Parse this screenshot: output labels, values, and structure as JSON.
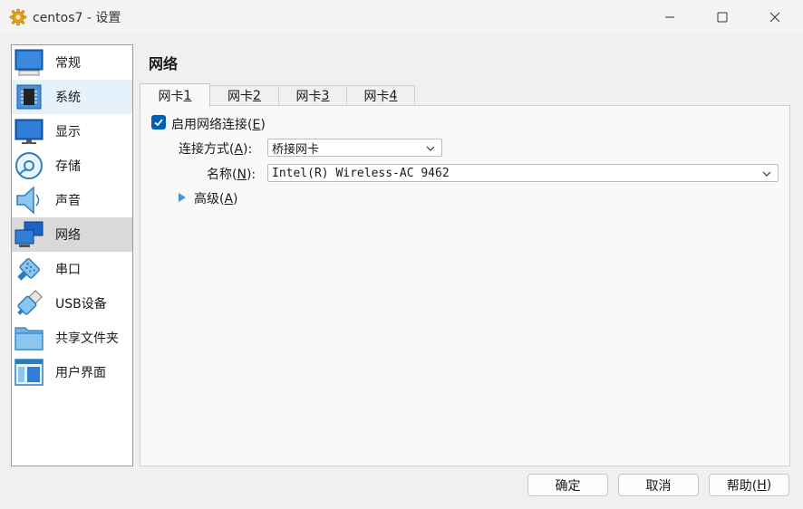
{
  "window": {
    "title": "centos7 - 设置",
    "icon": "gear-icon",
    "controls": [
      "minimize-icon",
      "maximize-icon",
      "close-icon"
    ]
  },
  "sidebar": {
    "items": [
      {
        "label": "常规",
        "icon": "general-icon",
        "state": "normal"
      },
      {
        "label": "系统",
        "icon": "system-chip-icon",
        "state": "hover"
      },
      {
        "label": "显示",
        "icon": "display-icon",
        "state": "normal"
      },
      {
        "label": "存储",
        "icon": "storage-disk-icon",
        "state": "normal"
      },
      {
        "label": "声音",
        "icon": "speaker-icon",
        "state": "normal"
      },
      {
        "label": "网络",
        "icon": "network-icon",
        "state": "selected"
      },
      {
        "label": "串口",
        "icon": "serial-port-icon",
        "state": "normal"
      },
      {
        "label": "USB设备",
        "icon": "usb-icon",
        "state": "normal"
      },
      {
        "label": "共享文件夹",
        "icon": "folder-icon",
        "state": "normal"
      },
      {
        "label": "用户界面",
        "icon": "user-interface-icon",
        "state": "normal"
      }
    ]
  },
  "main": {
    "section_title": "网络",
    "tabs": [
      {
        "label": "网卡 ",
        "accel": "1",
        "active": true
      },
      {
        "label": "网卡 ",
        "accel": "2",
        "active": false
      },
      {
        "label": "网卡 ",
        "accel": "3",
        "active": false
      },
      {
        "label": "网卡 ",
        "accel": "4",
        "active": false
      }
    ],
    "enable_adapter": {
      "label": "启用网络连接(",
      "accel": "E",
      "suffix": ")",
      "checked": true
    },
    "attached_to": {
      "label": "连接方式(",
      "accel": "A",
      "suffix": "):",
      "value": "桥接网卡"
    },
    "name": {
      "label": "名称(",
      "accel": "N",
      "suffix": "):",
      "value": "Intel(R) Wireless-AC 9462"
    },
    "advanced": {
      "label": "高级(",
      "accel": "A",
      "suffix": ")"
    }
  },
  "footer": {
    "ok_label": "确定",
    "cancel_label": "取消",
    "help_label": "帮助(",
    "help_accel": "H",
    "help_suffix": ")"
  },
  "colors": {
    "accent": "#005fb8",
    "selected_bg": "#d9d9d9",
    "hover_bg": "#e5f1fb"
  }
}
